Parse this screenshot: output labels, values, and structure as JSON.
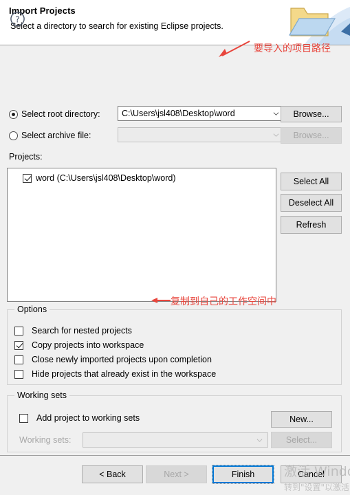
{
  "header": {
    "title": "Import Projects",
    "subtitle": "Select a directory to search for existing Eclipse projects.",
    "icon": "import-folder-icon"
  },
  "source": {
    "root_directory": {
      "radio_label": "Select root directory:",
      "selected": true,
      "value": "C:\\Users\\jsl408\\Desktop\\word",
      "browse_label": "Browse...",
      "browse_enabled": true
    },
    "archive_file": {
      "radio_label": "Select archive file:",
      "selected": false,
      "value": "",
      "browse_label": "Browse...",
      "browse_enabled": false
    }
  },
  "projects": {
    "label": "Projects:",
    "items": [
      {
        "checked": true,
        "text": "word (C:\\Users\\jsl408\\Desktop\\word)"
      }
    ],
    "buttons": {
      "select_all": "Select All",
      "deselect_all": "Deselect All",
      "refresh": "Refresh"
    }
  },
  "options": {
    "title": "Options",
    "items": [
      {
        "label": "Search for nested projects",
        "checked": false
      },
      {
        "label": "Copy projects into workspace",
        "checked": true
      },
      {
        "label": "Close newly imported projects upon completion",
        "checked": false
      },
      {
        "label": "Hide projects that already exist in the workspace",
        "checked": false
      }
    ]
  },
  "working_sets": {
    "title": "Working sets",
    "add_label": "Add project to working sets",
    "add_checked": false,
    "combo_label": "Working sets:",
    "combo_value": "",
    "combo_enabled": false,
    "new_label": "New...",
    "new_enabled": true,
    "select_label": "Select...",
    "select_enabled": false
  },
  "footer": {
    "help_icon": "help-question-icon",
    "back_label": "< Back",
    "back_enabled": true,
    "next_label": "Next >",
    "next_enabled": false,
    "finish_label": "Finish",
    "finish_enabled": true,
    "cancel_label": "Cancel",
    "cancel_enabled": true
  },
  "annotations": {
    "color": "#e8453c",
    "path_note": "要导入的项目路径",
    "copy_note": "复制到自己的工作空间中"
  },
  "watermark": {
    "line1": "激活 Windows",
    "line2": "转到\"设置\"以激活 Windows。"
  }
}
